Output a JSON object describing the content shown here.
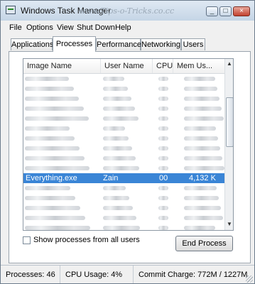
{
  "window": {
    "title": "Windows Task Manager",
    "watermark": "www.Tips-o-Tricks.co.cc",
    "controls": [
      "_",
      "□",
      "×"
    ]
  },
  "menu": [
    "File",
    "Options",
    "View",
    "Shut Down",
    "Help"
  ],
  "tabs": [
    "Applications",
    "Processes",
    "Performance",
    "Networking",
    "Users"
  ],
  "active_tab": "Processes",
  "table": {
    "headers": [
      "Image Name",
      "User Name",
      "CPU",
      "Mem Us..."
    ],
    "selected_row": {
      "image": "Everything.exe",
      "user": "Zain",
      "cpu": "00",
      "mem": "4,132 K"
    }
  },
  "scroll": {
    "up": "▲",
    "down": "▼"
  },
  "show_all_label": "Show processes from all users",
  "end_process_label": "End Process",
  "status": {
    "processes": "Processes: 46",
    "cpu": "CPU Usage: 4%",
    "commit": "Commit Charge: 772M / 1227M"
  },
  "colors": {
    "selection": "#3a85d6",
    "titlebar": "#c5d5e6"
  }
}
